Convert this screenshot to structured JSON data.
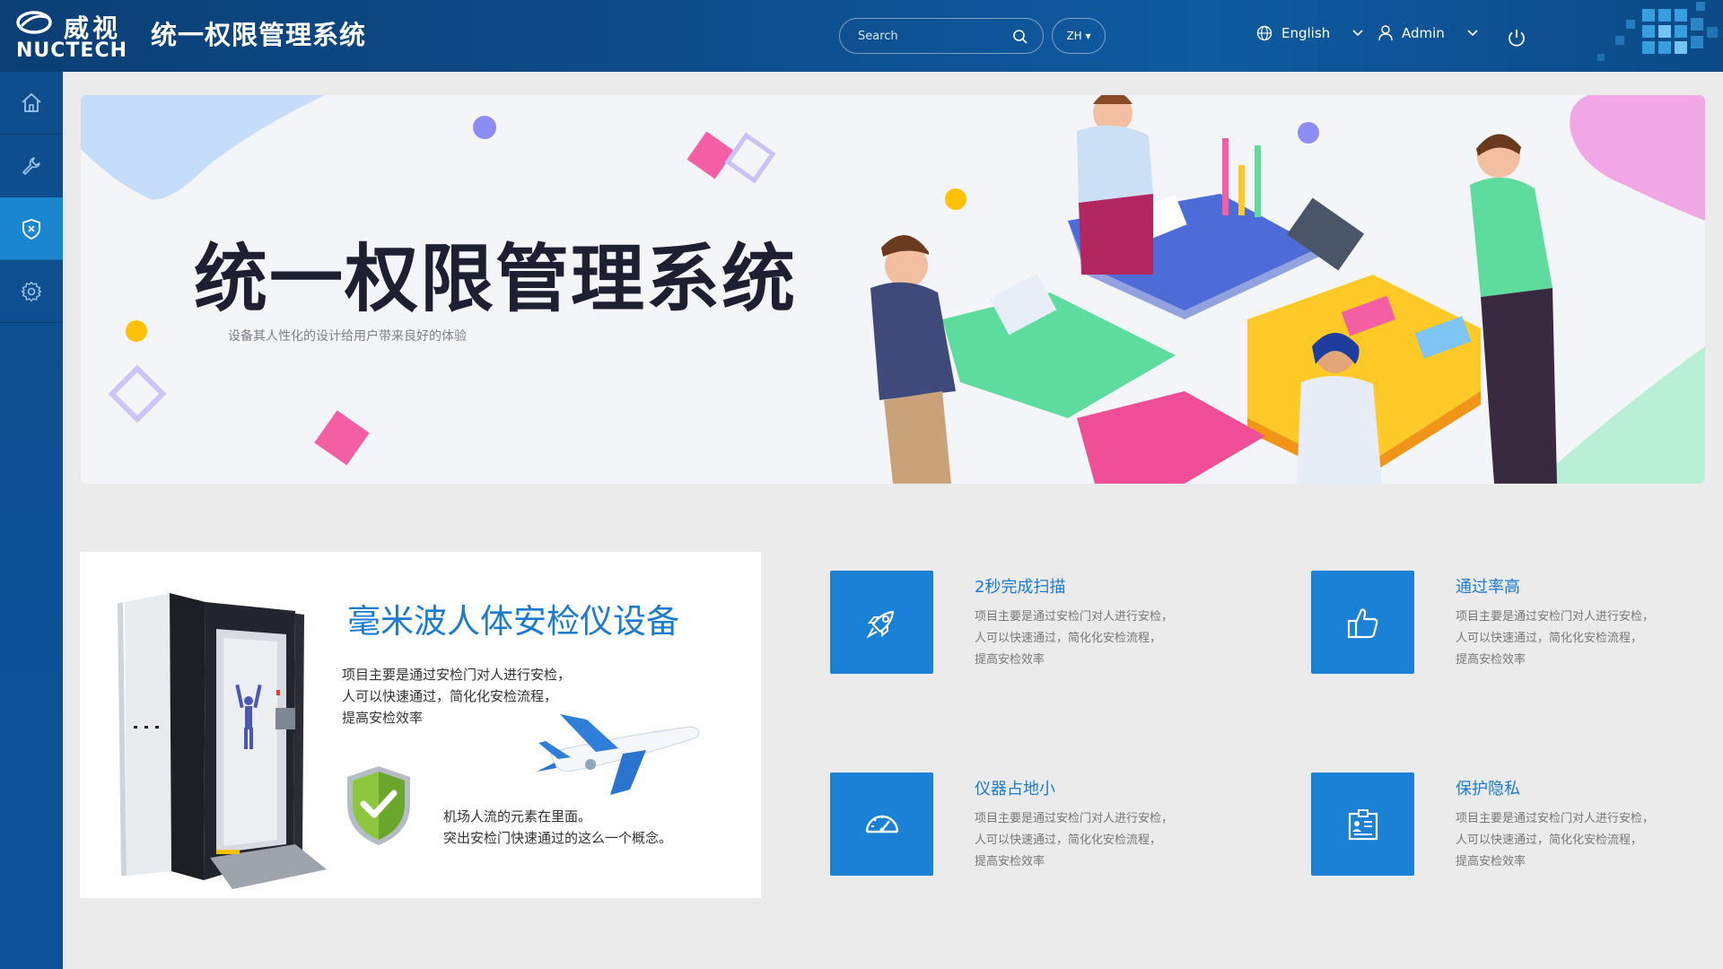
{
  "header": {
    "logo_cn": "威视",
    "logo_en": "NUCTECH",
    "app_title": "统一权限管理系统",
    "search": {
      "placeholder": "Search",
      "icon": "search-icon"
    },
    "lang_short": "ZH",
    "language": "English",
    "user": "Admin"
  },
  "sidebar": {
    "items": [
      {
        "name": "home",
        "icon": "home-icon"
      },
      {
        "name": "tools",
        "icon": "wrench-icon"
      },
      {
        "name": "security",
        "icon": "shield-icon",
        "active": true
      },
      {
        "name": "settings",
        "icon": "gear-icon"
      }
    ]
  },
  "banner": {
    "title": "统一权限管理系统",
    "subtitle": "设备其人性化的设计给用户带来良好的体验"
  },
  "product": {
    "title": "毫米波人体安检仪设备",
    "description": "项目主要是通过安检门对人进行安检，\n人可以快速通过，简化化安检流程，\n提高安检效率",
    "note": "机场人流的元素在里面。\n突出安检门快速通过的这么一个概念。"
  },
  "features": [
    {
      "title": "2秒完成扫描",
      "desc": "项目主要是通过安检门对人进行安检，\n人可以快速通过，简化化安检流程，\n提高安检效率",
      "icon": "rocket-icon"
    },
    {
      "title": "通过率高",
      "desc": "项目主要是通过安检门对人进行安检，\n人可以快速通过，简化化安检流程，\n提高安检效率",
      "icon": "thumbs-up-icon"
    },
    {
      "title": "仪器占地小",
      "desc": "项目主要是通过安检门对人进行安检，\n人可以快速通过，简化化安检流程，\n提高安检效率",
      "icon": "gauge-icon"
    },
    {
      "title": "保护隐私",
      "desc": "项目主要是通过安检门对人进行安检，\n人可以快速通过，简化化安检流程，\n提高安检效率",
      "icon": "id-card-icon"
    }
  ],
  "colors": {
    "header": "#0e4d8c",
    "sidebar_active": "#1a86cf",
    "accent": "#1a81d6",
    "feature_title": "#1a7bd1"
  }
}
